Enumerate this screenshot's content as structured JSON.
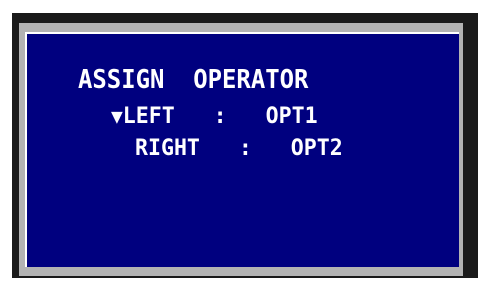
{
  "osd": {
    "title": "ASSIGN  OPERATOR",
    "rows": [
      {
        "cursor": "▼",
        "label": "LEFT",
        "separator": ":",
        "value": "OPT1"
      },
      {
        "label": "RIGHT",
        "separator": ":",
        "value": "OPT2"
      }
    ]
  },
  "colors": {
    "screen_background": "#00007f",
    "text": "#ffffff",
    "bezel": "#1a1a1a",
    "bezel_inner": "#b3b3b3"
  }
}
